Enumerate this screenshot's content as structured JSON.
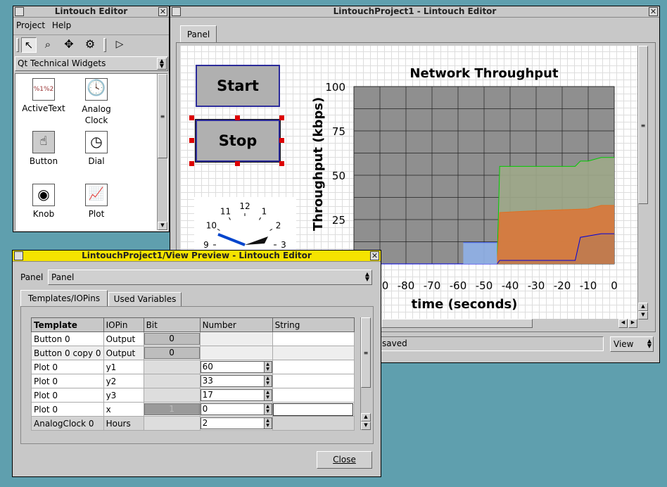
{
  "toolbox": {
    "title": "Lintouch Editor",
    "close": "✕",
    "menu": [
      "Project",
      "Help"
    ],
    "combo": "Qt Technical Widgets",
    "widgets": [
      "ActiveText",
      "Analog Clock",
      "Button",
      "Dial",
      "Knob",
      "Plot"
    ],
    "active_text_glyph": "%1%2"
  },
  "editor": {
    "title": "LintouchProject1 - Lintouch Editor",
    "close": "✕",
    "tab": "Panel",
    "start_label": "Start",
    "stop_label": "Stop",
    "status": "saved",
    "view_label": "View"
  },
  "chart_data": {
    "type": "area",
    "title": "Network Throughput",
    "xlabel": "time (seconds)",
    "ylabel": "Throughput (kbps)",
    "x_ticks": [
      "-90",
      "-80",
      "-70",
      "-60",
      "-50",
      "-40",
      "-30",
      "-20",
      "-10",
      "0"
    ],
    "y_ticks": [
      "25",
      "50",
      "75",
      "100"
    ],
    "xlim": [
      -100,
      0
    ],
    "ylim": [
      0,
      100
    ],
    "grid": true,
    "series": [
      {
        "color": "#00cc00",
        "x": [
          -100,
          -45,
          -44,
          -15,
          -13,
          -10,
          -5,
          0
        ],
        "values": [
          0,
          0,
          55,
          55,
          58,
          58,
          60,
          60
        ]
      },
      {
        "color": "#e07020",
        "x": [
          -100,
          -45,
          -44,
          -30,
          -10,
          -5,
          0
        ],
        "values": [
          0,
          0,
          29,
          30,
          31,
          33,
          33
        ]
      },
      {
        "color": "#0000dd",
        "x": [
          -100,
          -45,
          -44,
          -15,
          -13,
          -5,
          0
        ],
        "values": [
          0,
          0,
          2,
          2,
          15,
          17,
          17
        ]
      },
      {
        "color": "#4466ff",
        "x": [
          -58,
          -45
        ],
        "values": [
          12,
          12
        ]
      }
    ],
    "clock_numbers": [
      "12",
      "1",
      "2",
      "3",
      "9",
      "10",
      "11"
    ]
  },
  "preview": {
    "title": "LintouchProject1/View Preview - Lintouch Editor",
    "close": "✕",
    "panel_label": "Panel",
    "panel_value": "Panel",
    "tabs": [
      "Templates/IOPins",
      "Used Variables"
    ],
    "columns": [
      "Template",
      "IOPin",
      "Bit",
      "Number",
      "String"
    ],
    "rows": [
      {
        "template": "Button 0",
        "iopin": "Output",
        "bit": "0",
        "number": "",
        "string": ""
      },
      {
        "template": "Button 0 copy 0",
        "iopin": "Output",
        "bit": "0",
        "number": "",
        "string": ""
      },
      {
        "template": "Plot 0",
        "iopin": "y1",
        "bit": "",
        "number": "60",
        "string": ""
      },
      {
        "template": "Plot 0",
        "iopin": "y2",
        "bit": "",
        "number": "33",
        "string": ""
      },
      {
        "template": "Plot 0",
        "iopin": "y3",
        "bit": "",
        "number": "17",
        "string": ""
      },
      {
        "template": "Plot 0",
        "iopin": "x",
        "bit": "1",
        "number": "0",
        "string": ""
      },
      {
        "template": "AnalogClock 0",
        "iopin": "Hours",
        "bit": "",
        "number": "2",
        "string": ""
      }
    ],
    "close_label": "Close"
  }
}
